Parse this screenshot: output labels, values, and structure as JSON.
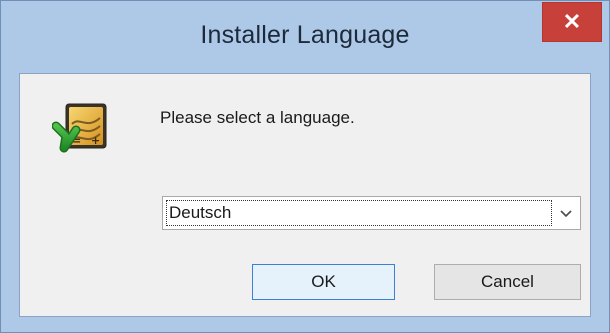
{
  "window": {
    "title": "Installer Language",
    "close_symbol": "✕"
  },
  "dialog": {
    "prompt": "Please select a language.",
    "language_select": {
      "selected": "Deutsch"
    },
    "buttons": {
      "ok": "OK",
      "cancel": "Cancel"
    }
  },
  "icons": {
    "app": "installer-icon",
    "close": "close-icon",
    "dropdown": "chevron-down-icon"
  },
  "colors": {
    "title_bar": "#aec8e8",
    "close_button": "#c7413a",
    "client_bg": "#f0f0f0",
    "default_button_border": "#3c7fd6"
  }
}
